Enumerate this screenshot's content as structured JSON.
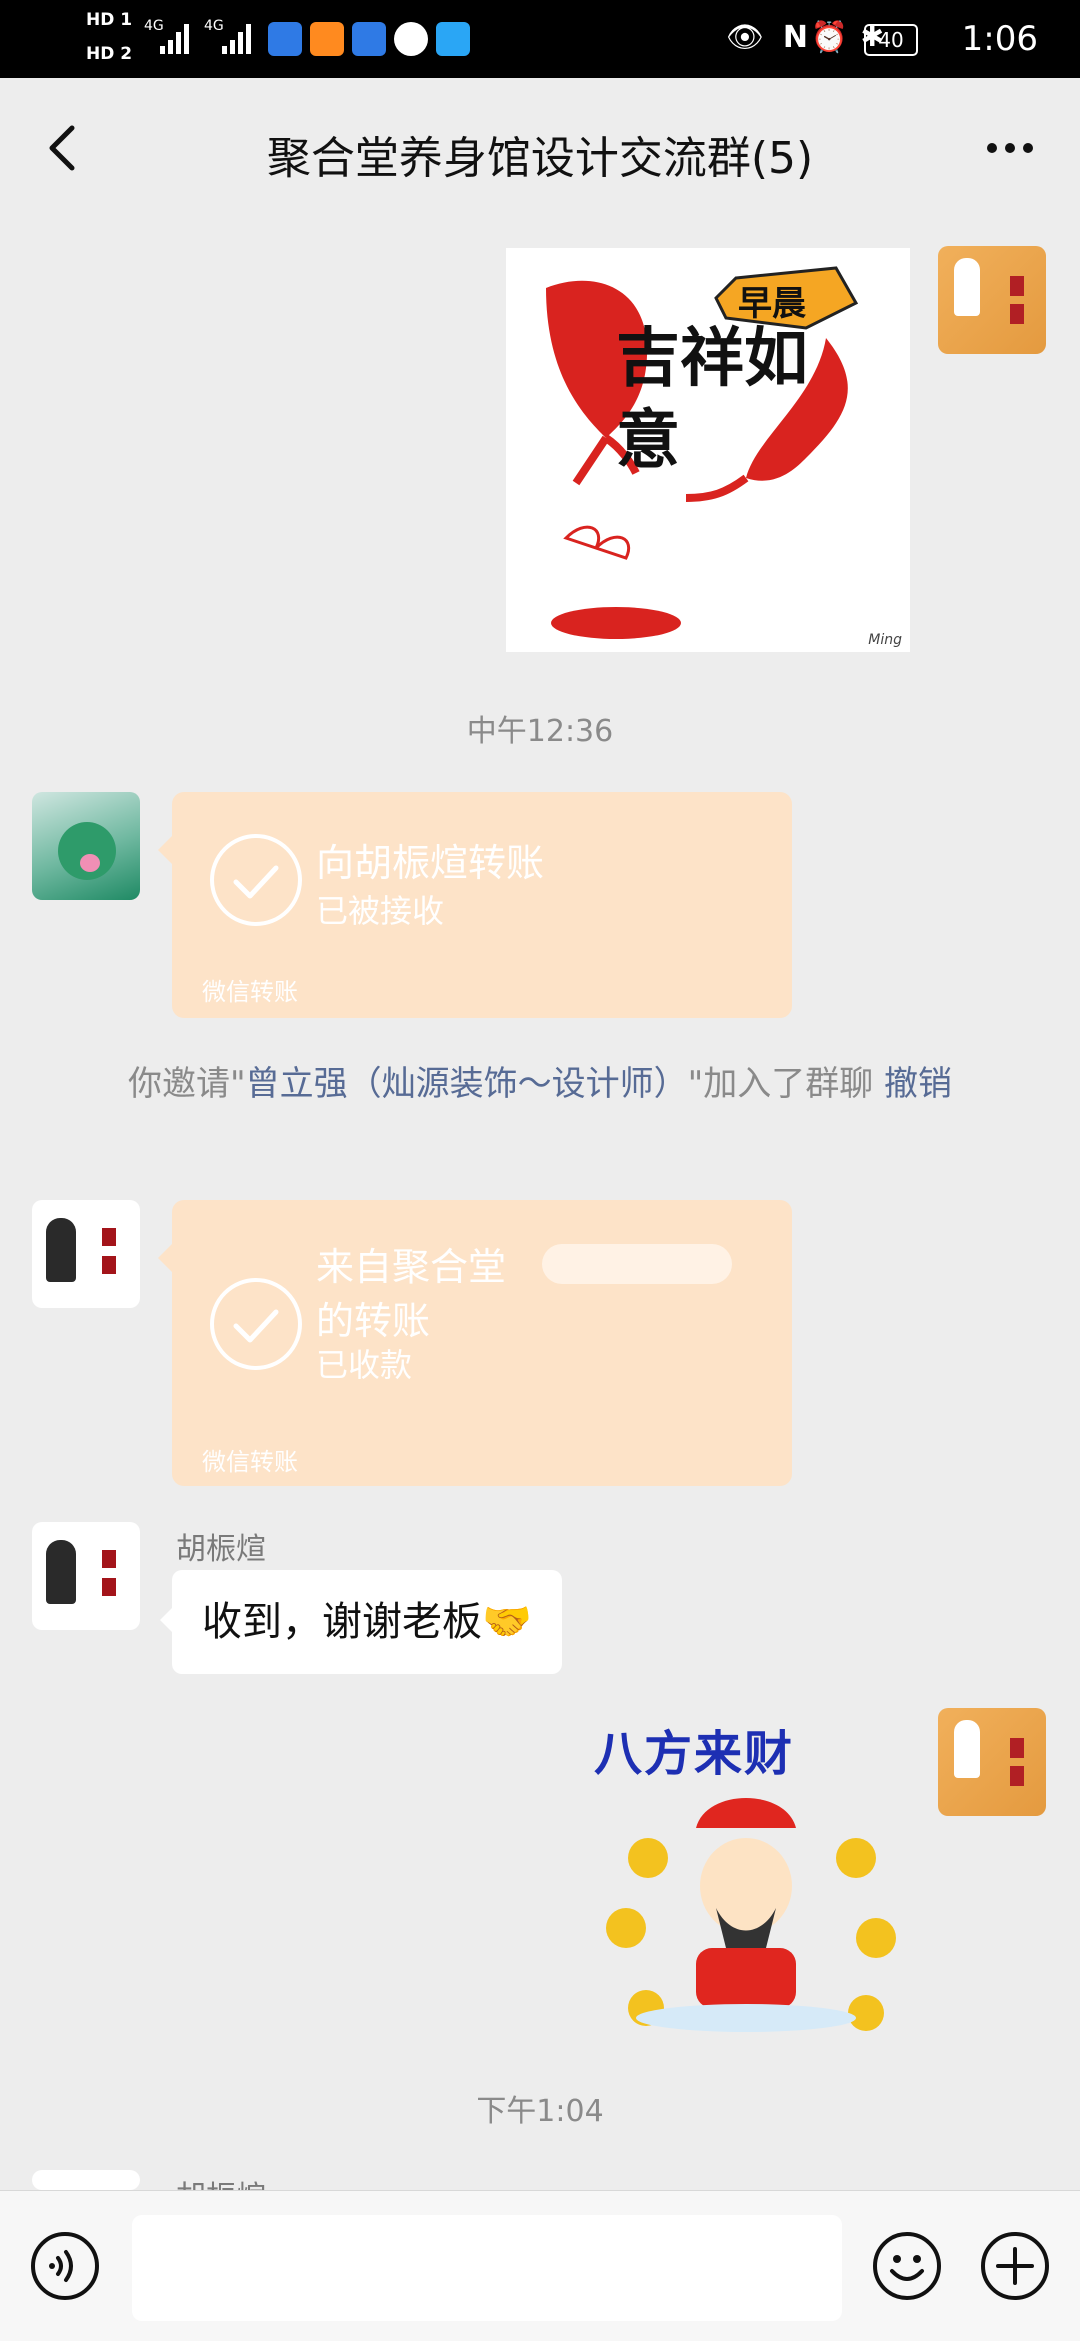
{
  "status_bar": {
    "sim1": "HD 1",
    "sim2": "HD 2",
    "net1": "4G",
    "net2": "4G",
    "battery": "40",
    "time": "1:06"
  },
  "header": {
    "title": "聚合堂养身馆设计交流群(5)"
  },
  "messages": {
    "time1": "中午12:36",
    "time2": "下午1:04",
    "transfer1": {
      "title": "向胡桭煊转账",
      "status": "已被接收",
      "footer": "微信转账"
    },
    "system": {
      "prefix": "你邀请\"",
      "name": "曾立强（灿源装饰～设计师）",
      "suffix": "\"加入了群聊",
      "action": "撤销"
    },
    "transfer2": {
      "title_line1": "来自聚合堂",
      "title_line2": "的转账",
      "status": "已收款",
      "footer": "微信转账"
    },
    "text1": {
      "sender": "胡桭煊",
      "text": "收到，谢谢老板🤝"
    },
    "sticker1": {
      "text_main": "吉祥如意",
      "badge": "早晨",
      "signature": "Ming"
    },
    "sticker2": {
      "text": "八方来财"
    },
    "partial_sender": "胡桭煊"
  }
}
